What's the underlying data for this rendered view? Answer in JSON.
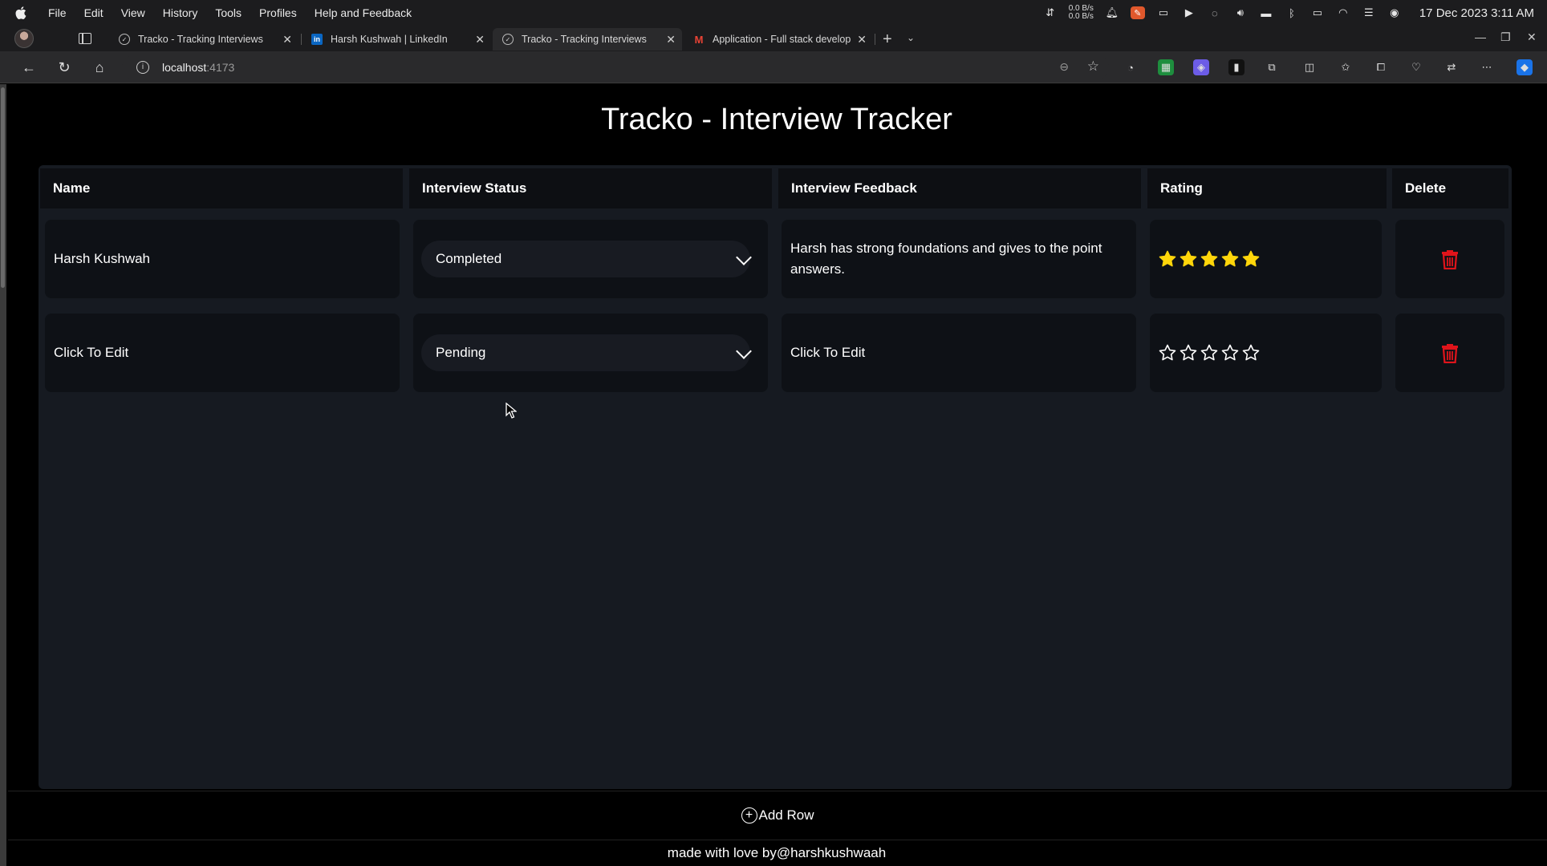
{
  "menubar": {
    "items": [
      "File",
      "Edit",
      "View",
      "History",
      "Tools",
      "Profiles",
      "Help and Feedback"
    ],
    "net_up": "0.0 B/s",
    "net_down": "0.0 B/s",
    "datetime": "17 Dec 2023  3:11 AM"
  },
  "tabs": [
    {
      "title": "Tracko - Tracking Interviews",
      "active": false
    },
    {
      "title": "Harsh Kushwah | LinkedIn",
      "active": false
    },
    {
      "title": "Tracko - Tracking Interviews",
      "active": true
    },
    {
      "title": "Application - Full stack develop",
      "active": false
    }
  ],
  "address": {
    "host": "localhost",
    "port": ":4173"
  },
  "page": {
    "title": "Tracko - Interview Tracker",
    "columns": [
      "Name",
      "Interview Status",
      "Interview Feedback",
      "Rating",
      "Delete"
    ],
    "rows": [
      {
        "name": "Harsh Kushwah",
        "status": "Completed",
        "feedback": "Harsh has strong foundations and gives to the point answers.",
        "rating": 5
      },
      {
        "name": "Click To Edit",
        "status": "Pending",
        "feedback": "Click To Edit",
        "rating": 0
      }
    ],
    "max_rating": 5,
    "add_row_label": "Add Row",
    "footer": "made with love by@harshkushwaah"
  },
  "colors": {
    "star_filled": "#ffd60a",
    "delete_icon": "#e0141b"
  }
}
